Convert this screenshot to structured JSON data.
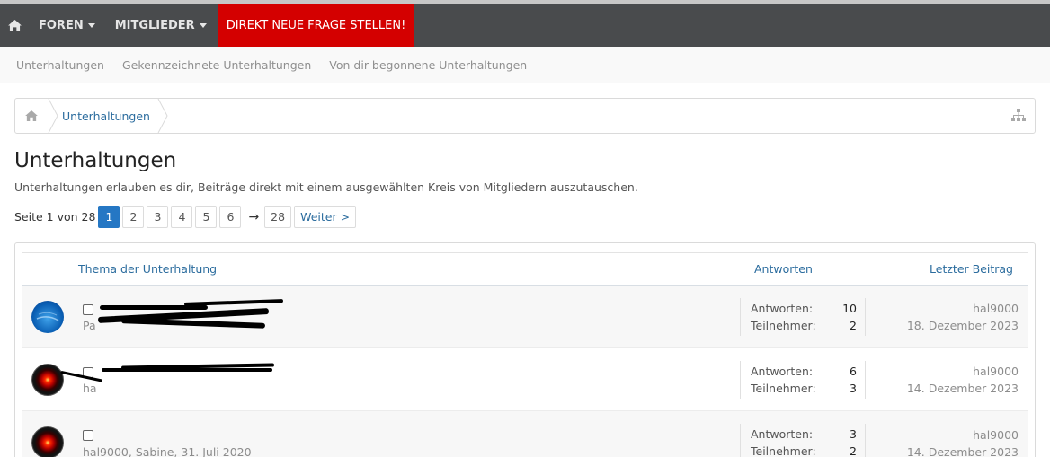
{
  "nav": {
    "home_icon": "home-icon",
    "items": [
      {
        "label": "FOREN"
      },
      {
        "label": "MITGLIEDER"
      }
    ],
    "cta": "DIREKT NEUE FRAGE STELLEN!",
    "cta_color": "#d40000",
    "bar_color": "#494b4d"
  },
  "subnav": {
    "items": [
      "Unterhaltungen",
      "Gekennzeichnete Unterhaltungen",
      "Von dir begonnene Unterhaltungen"
    ]
  },
  "breadcrumb": {
    "home_icon": "home-icon",
    "current": "Unterhaltungen",
    "sitemap_icon": "sitemap-icon"
  },
  "page": {
    "title": "Unterhaltungen",
    "description": "Unterhaltungen erlauben es dir, Beiträge direkt mit einem ausgewählten Kreis von Mitgliedern auszutauschen."
  },
  "pager": {
    "label": "Seite 1 von 28",
    "pages": [
      "1",
      "2",
      "3",
      "4",
      "5",
      "6"
    ],
    "current": "1",
    "arrow": "→",
    "last": "28",
    "next": "Weiter >"
  },
  "table": {
    "col_topic": "Thema der Unterhaltung",
    "col_replies": "Antworten",
    "col_last": "Letzter Beitrag",
    "rows": [
      {
        "avatar": "windows-logo-avatar",
        "meta": "Pa",
        "replies_label": "Antworten:",
        "replies": "10",
        "participants_label": "Teilnehmer:",
        "participants": "2",
        "last_user": "hal9000",
        "last_date": "18. Dezember 2023"
      },
      {
        "avatar": "hal9000-eye-avatar",
        "meta": "ha",
        "replies_label": "Antworten:",
        "replies": "6",
        "participants_label": "Teilnehmer:",
        "participants": "3",
        "last_user": "hal9000",
        "last_date": "14. Dezember 2023"
      },
      {
        "avatar": "hal9000-eye-avatar",
        "meta": "hal9000, Sabine, 31. Juli 2020",
        "replies_label": "Antworten:",
        "replies": "3",
        "participants_label": "Teilnehmer:",
        "participants": "2",
        "last_user": "hal9000",
        "last_date": "14. Dezember 2023"
      }
    ]
  }
}
